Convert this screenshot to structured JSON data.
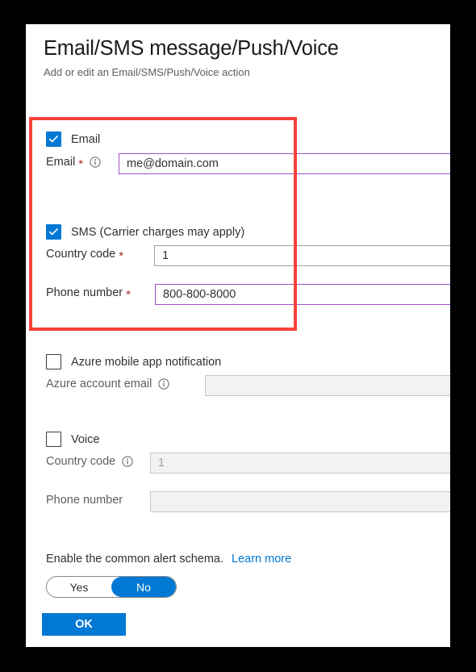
{
  "blade": {
    "title": "Email/SMS message/Push/Voice",
    "subtitle": "Add or edit an Email/SMS/Push/Voice action"
  },
  "email_section": {
    "checkbox_label": "Email",
    "checked": true,
    "field_label": "Email",
    "required_marker": "*",
    "info_icon": "info-icon",
    "input_value": "me@domain.com",
    "input_placeholder": ""
  },
  "sms_section": {
    "checkbox_label": "SMS (Carrier charges may apply)",
    "checked": true,
    "country_code_label": "Country code",
    "country_code_required": "*",
    "country_code_value": "1",
    "phone_label": "Phone number",
    "phone_required": "*",
    "phone_value": "800-800-8000"
  },
  "push_section": {
    "checkbox_label": "Azure mobile app notification",
    "checked": false,
    "account_email_label": "Azure account email",
    "info_icon": "info-icon",
    "account_email_value": "",
    "account_email_placeholder": ""
  },
  "voice_section": {
    "checkbox_label": "Voice",
    "checked": false,
    "country_code_label": "Country code",
    "info_icon": "info-icon",
    "country_code_value": "",
    "country_code_placeholder": "1",
    "phone_label": "Phone number",
    "phone_value": "",
    "phone_placeholder": ""
  },
  "common_schema": {
    "text": "Enable the common alert schema.",
    "link_label": "Learn more",
    "toggle_yes": "Yes",
    "toggle_no": "No",
    "selected": "No"
  },
  "footer": {
    "ok_label": "OK"
  },
  "colors": {
    "accent": "#0078d4",
    "required": "#a4262c",
    "focus_border": "#a64dca",
    "annotation": "#f9423a",
    "disabled_fill": "#f3f2f1"
  }
}
